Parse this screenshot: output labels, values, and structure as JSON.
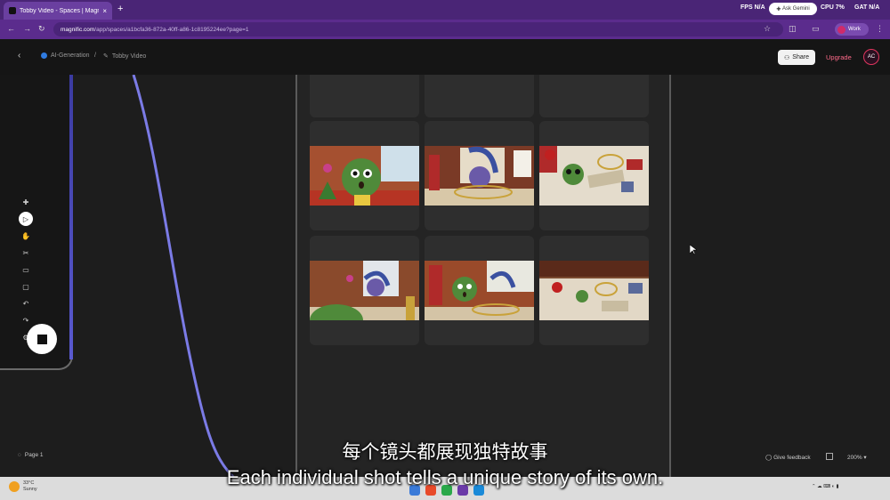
{
  "browser": {
    "tab_title": "Tobby Video - Spaces | Magnif",
    "tab_close": "×",
    "new_tab": "+",
    "url_site": "magnific.com",
    "url_path": "/app/spaces/a1bcfa36-872a-40ff-a86-1c8195224ee?page=1",
    "ask_button": "Ask Gemini",
    "fps_label": "FPS",
    "fps_value": "N/A",
    "cpu_label": "CPU",
    "cpu_value": "7%",
    "gpu_label": "GAT",
    "gpu_value": "N/A",
    "profile_label": "Work"
  },
  "header": {
    "breadcrumb_1": "AI-Generation",
    "breadcrumb_2": "Tobby Video",
    "share_label": "Share",
    "upgrade_label": "Upgrade",
    "avatar_initials": "AC"
  },
  "canvas": {
    "page_label": "Page 1",
    "feedback_label": "Give feedback",
    "zoom_level": "200%"
  },
  "subtitles": {
    "chinese": "每个镜头都展现独特故事",
    "english": "Each individual shot tells a unique story of its own."
  },
  "taskbar": {
    "temperature": "33°C",
    "weather": "Sunny",
    "notification_count": "3"
  },
  "colors": {
    "tab_bar": "#4a2576",
    "address_bar": "#5b2c8d",
    "curve": "#7b7be6",
    "upgrade": "#ff6a8a"
  }
}
